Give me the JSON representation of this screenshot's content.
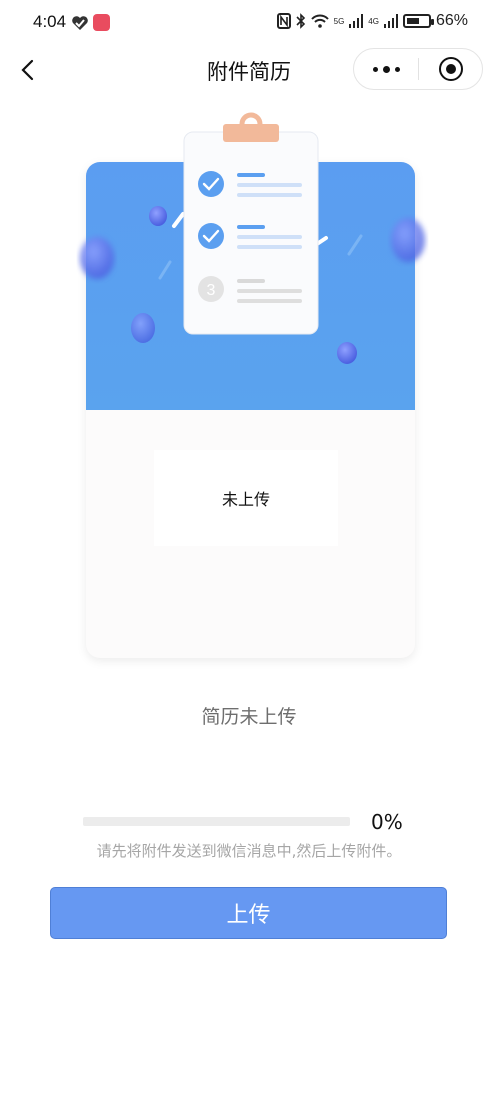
{
  "status_bar": {
    "time": "4:04",
    "network_5g": "5G",
    "network_4g": "4G",
    "battery": "66%",
    "battery_level": 0.66
  },
  "nav": {
    "title": "附件简历"
  },
  "card": {
    "step_number": "3",
    "upload_state": "未上传"
  },
  "resume_status": "简历未上传",
  "progress": {
    "value": 0,
    "label": "0%"
  },
  "hint": "请先将附件发送到微信消息中,然后上传附件。",
  "upload_button": "上传",
  "colors": {
    "accent": "#6698f2",
    "banner": "#5b9df1",
    "check": "#5b9ff0",
    "clip": "#f2b99a"
  }
}
